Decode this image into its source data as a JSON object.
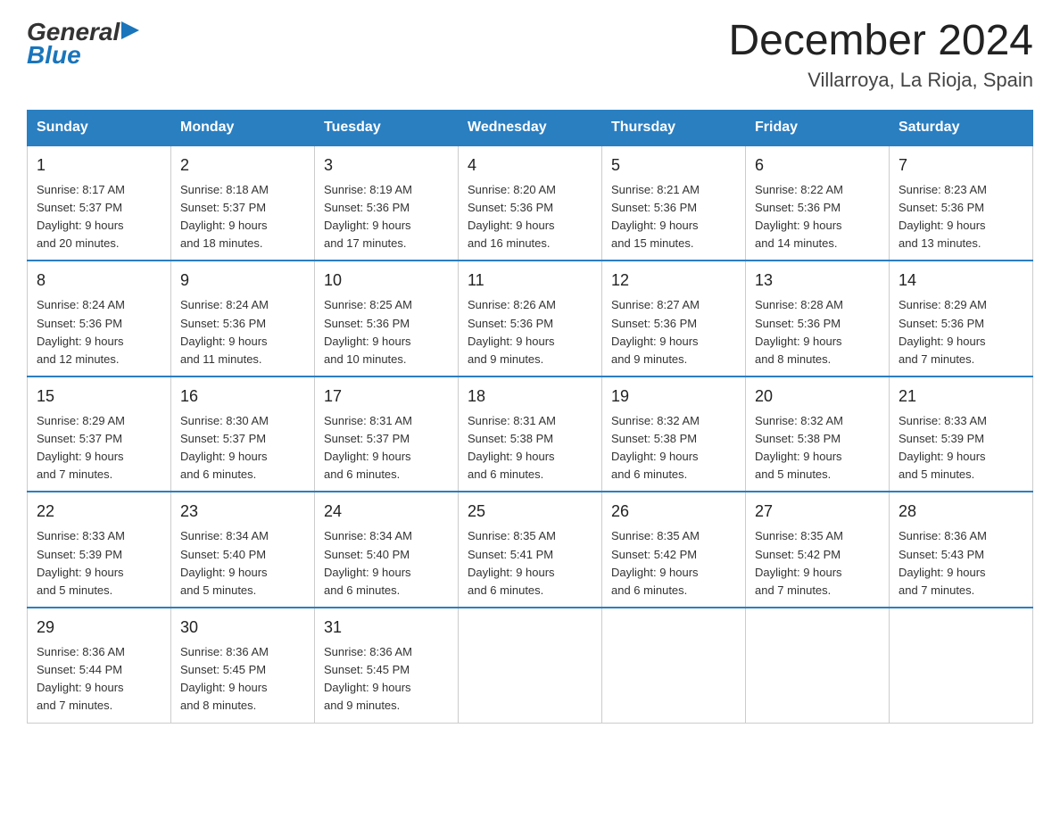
{
  "header": {
    "logo_general": "General",
    "logo_blue": "Blue",
    "main_title": "December 2024",
    "subtitle": "Villarroya, La Rioja, Spain"
  },
  "days_of_week": [
    "Sunday",
    "Monday",
    "Tuesday",
    "Wednesday",
    "Thursday",
    "Friday",
    "Saturday"
  ],
  "weeks": [
    [
      {
        "day": "1",
        "sunrise": "8:17 AM",
        "sunset": "5:37 PM",
        "daylight": "9 hours and 20 minutes."
      },
      {
        "day": "2",
        "sunrise": "8:18 AM",
        "sunset": "5:37 PM",
        "daylight": "9 hours and 18 minutes."
      },
      {
        "day": "3",
        "sunrise": "8:19 AM",
        "sunset": "5:36 PM",
        "daylight": "9 hours and 17 minutes."
      },
      {
        "day": "4",
        "sunrise": "8:20 AM",
        "sunset": "5:36 PM",
        "daylight": "9 hours and 16 minutes."
      },
      {
        "day": "5",
        "sunrise": "8:21 AM",
        "sunset": "5:36 PM",
        "daylight": "9 hours and 15 minutes."
      },
      {
        "day": "6",
        "sunrise": "8:22 AM",
        "sunset": "5:36 PM",
        "daylight": "9 hours and 14 minutes."
      },
      {
        "day": "7",
        "sunrise": "8:23 AM",
        "sunset": "5:36 PM",
        "daylight": "9 hours and 13 minutes."
      }
    ],
    [
      {
        "day": "8",
        "sunrise": "8:24 AM",
        "sunset": "5:36 PM",
        "daylight": "9 hours and 12 minutes."
      },
      {
        "day": "9",
        "sunrise": "8:24 AM",
        "sunset": "5:36 PM",
        "daylight": "9 hours and 11 minutes."
      },
      {
        "day": "10",
        "sunrise": "8:25 AM",
        "sunset": "5:36 PM",
        "daylight": "9 hours and 10 minutes."
      },
      {
        "day": "11",
        "sunrise": "8:26 AM",
        "sunset": "5:36 PM",
        "daylight": "9 hours and 9 minutes."
      },
      {
        "day": "12",
        "sunrise": "8:27 AM",
        "sunset": "5:36 PM",
        "daylight": "9 hours and 9 minutes."
      },
      {
        "day": "13",
        "sunrise": "8:28 AM",
        "sunset": "5:36 PM",
        "daylight": "9 hours and 8 minutes."
      },
      {
        "day": "14",
        "sunrise": "8:29 AM",
        "sunset": "5:36 PM",
        "daylight": "9 hours and 7 minutes."
      }
    ],
    [
      {
        "day": "15",
        "sunrise": "8:29 AM",
        "sunset": "5:37 PM",
        "daylight": "9 hours and 7 minutes."
      },
      {
        "day": "16",
        "sunrise": "8:30 AM",
        "sunset": "5:37 PM",
        "daylight": "9 hours and 6 minutes."
      },
      {
        "day": "17",
        "sunrise": "8:31 AM",
        "sunset": "5:37 PM",
        "daylight": "9 hours and 6 minutes."
      },
      {
        "day": "18",
        "sunrise": "8:31 AM",
        "sunset": "5:38 PM",
        "daylight": "9 hours and 6 minutes."
      },
      {
        "day": "19",
        "sunrise": "8:32 AM",
        "sunset": "5:38 PM",
        "daylight": "9 hours and 6 minutes."
      },
      {
        "day": "20",
        "sunrise": "8:32 AM",
        "sunset": "5:38 PM",
        "daylight": "9 hours and 5 minutes."
      },
      {
        "day": "21",
        "sunrise": "8:33 AM",
        "sunset": "5:39 PM",
        "daylight": "9 hours and 5 minutes."
      }
    ],
    [
      {
        "day": "22",
        "sunrise": "8:33 AM",
        "sunset": "5:39 PM",
        "daylight": "9 hours and 5 minutes."
      },
      {
        "day": "23",
        "sunrise": "8:34 AM",
        "sunset": "5:40 PM",
        "daylight": "9 hours and 5 minutes."
      },
      {
        "day": "24",
        "sunrise": "8:34 AM",
        "sunset": "5:40 PM",
        "daylight": "9 hours and 6 minutes."
      },
      {
        "day": "25",
        "sunrise": "8:35 AM",
        "sunset": "5:41 PM",
        "daylight": "9 hours and 6 minutes."
      },
      {
        "day": "26",
        "sunrise": "8:35 AM",
        "sunset": "5:42 PM",
        "daylight": "9 hours and 6 minutes."
      },
      {
        "day": "27",
        "sunrise": "8:35 AM",
        "sunset": "5:42 PM",
        "daylight": "9 hours and 7 minutes."
      },
      {
        "day": "28",
        "sunrise": "8:36 AM",
        "sunset": "5:43 PM",
        "daylight": "9 hours and 7 minutes."
      }
    ],
    [
      {
        "day": "29",
        "sunrise": "8:36 AM",
        "sunset": "5:44 PM",
        "daylight": "9 hours and 7 minutes."
      },
      {
        "day": "30",
        "sunrise": "8:36 AM",
        "sunset": "5:45 PM",
        "daylight": "9 hours and 8 minutes."
      },
      {
        "day": "31",
        "sunrise": "8:36 AM",
        "sunset": "5:45 PM",
        "daylight": "9 hours and 9 minutes."
      },
      null,
      null,
      null,
      null
    ]
  ],
  "labels": {
    "sunrise": "Sunrise:",
    "sunset": "Sunset:",
    "daylight": "Daylight:"
  }
}
